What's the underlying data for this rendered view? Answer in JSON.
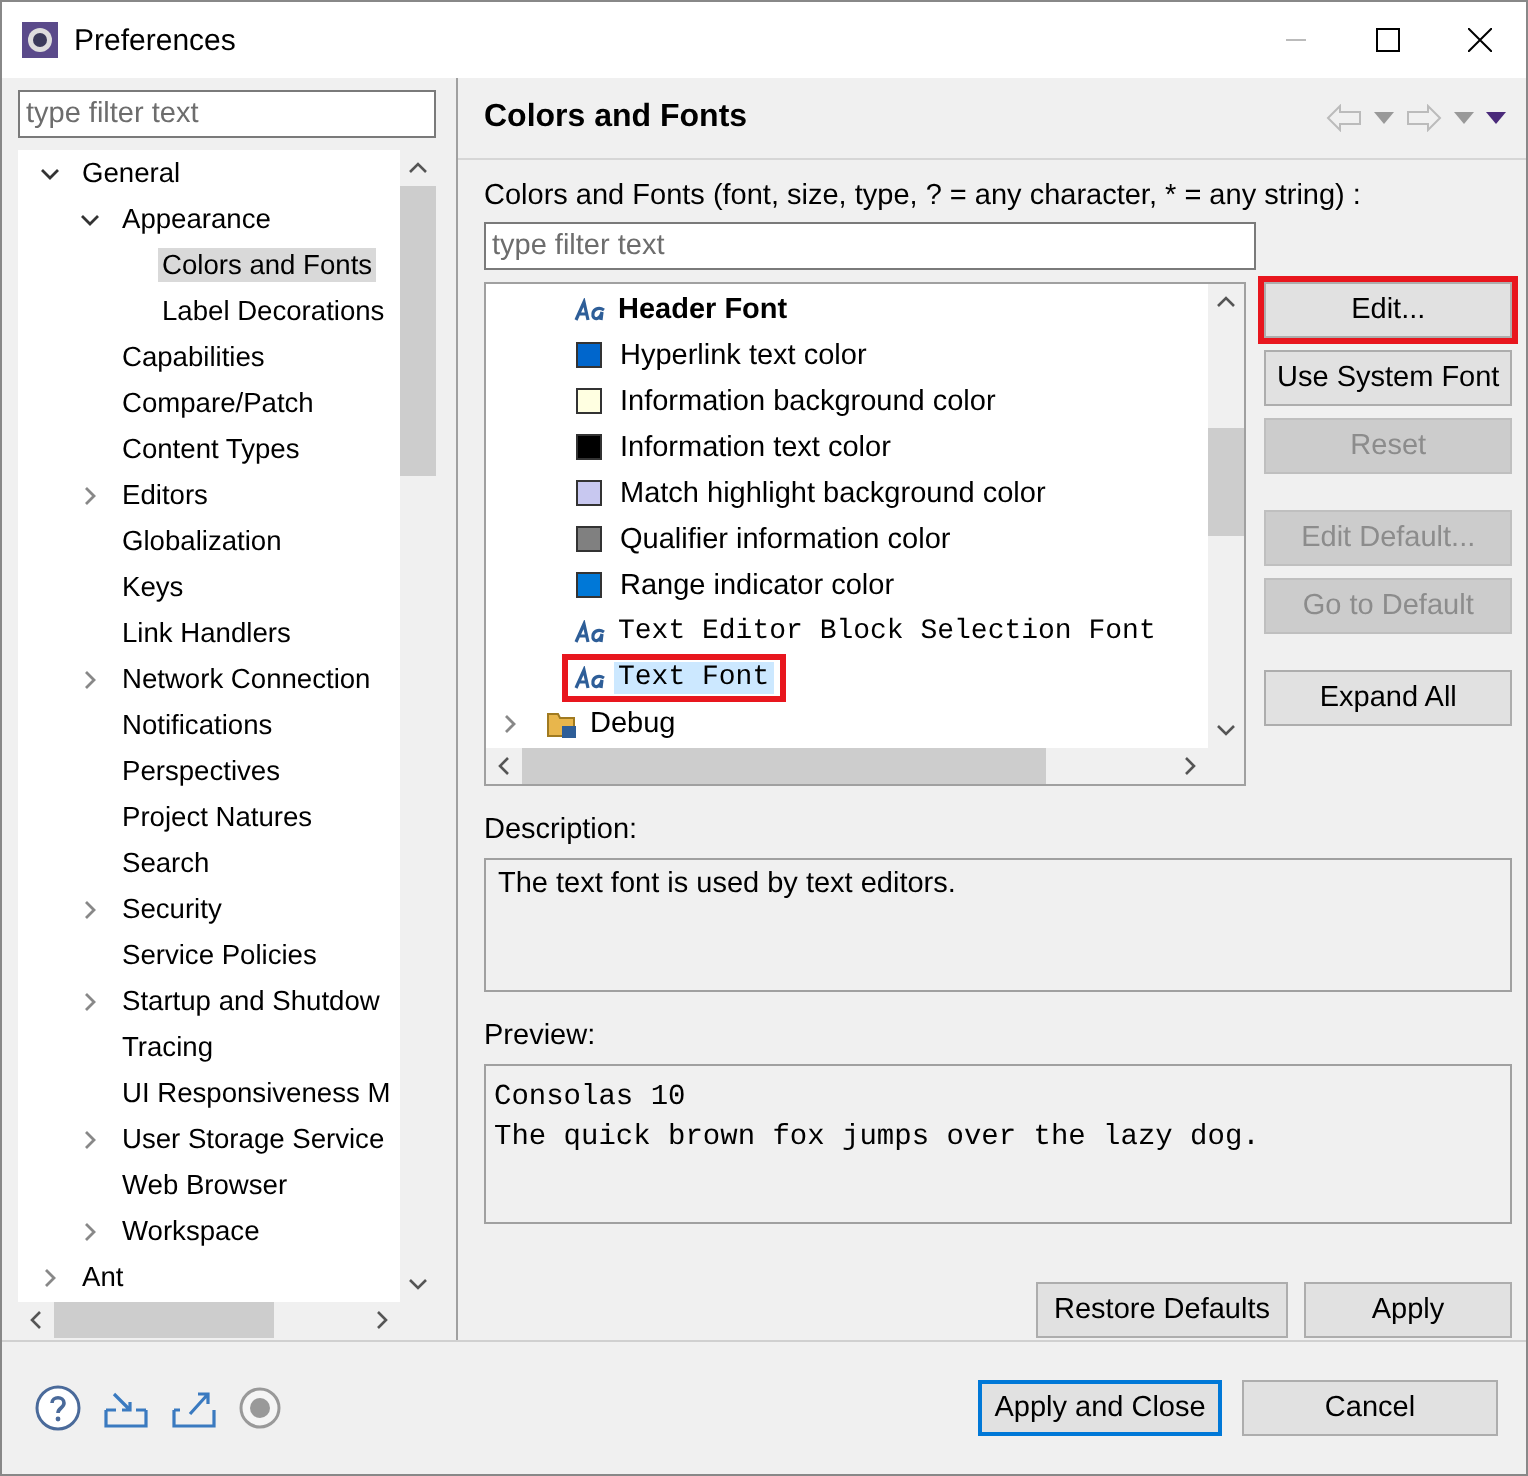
{
  "window": {
    "title": "Preferences"
  },
  "sidebar": {
    "filter": {
      "placeholder": "type filter text"
    },
    "tree": [
      {
        "label": "General",
        "expanded": true,
        "selected": false,
        "children": [
          {
            "label": "Appearance",
            "expanded": true,
            "selected": false,
            "children": [
              {
                "label": "Colors and Fonts",
                "selected": true
              },
              {
                "label": "Label Decorations",
                "selected": false
              }
            ]
          },
          {
            "label": "Capabilities",
            "selected": false
          },
          {
            "label": "Compare/Patch",
            "selected": false
          },
          {
            "label": "Content Types",
            "selected": false
          },
          {
            "label": "Editors",
            "expanded": false,
            "selected": false
          },
          {
            "label": "Globalization",
            "selected": false
          },
          {
            "label": "Keys",
            "selected": false
          },
          {
            "label": "Link Handlers",
            "selected": false
          },
          {
            "label": "Network Connection",
            "expanded": false,
            "selected": false
          },
          {
            "label": "Notifications",
            "selected": false
          },
          {
            "label": "Perspectives",
            "selected": false
          },
          {
            "label": "Project Natures",
            "selected": false
          },
          {
            "label": "Search",
            "selected": false
          },
          {
            "label": "Security",
            "expanded": false,
            "selected": false
          },
          {
            "label": "Service Policies",
            "selected": false
          },
          {
            "label": "Startup and Shutdow",
            "expanded": false,
            "selected": false
          },
          {
            "label": "Tracing",
            "selected": false
          },
          {
            "label": "UI Responsiveness M",
            "selected": false
          },
          {
            "label": "User Storage Service",
            "expanded": false,
            "selected": false
          },
          {
            "label": "Web Browser",
            "selected": false
          },
          {
            "label": "Workspace",
            "expanded": false,
            "selected": false
          }
        ]
      },
      {
        "label": "Ant",
        "expanded": false,
        "selected": false
      }
    ]
  },
  "page": {
    "title": "Colors and Fonts",
    "filter_label": "Colors and Fonts (font, size, type, ? = any character, * = any string) :",
    "filter": {
      "placeholder": "type filter text"
    },
    "items": [
      {
        "kind": "boldfont",
        "label": "Header Font",
        "selected": false,
        "highlighted": false
      },
      {
        "kind": "color",
        "label": "Hyperlink text color",
        "color": "#0066cc",
        "selected": false,
        "highlighted": false
      },
      {
        "kind": "color",
        "label": "Information background color",
        "color": "#ffffe1",
        "selected": false,
        "highlighted": false
      },
      {
        "kind": "color",
        "label": "Information text color",
        "color": "#000000",
        "selected": false,
        "highlighted": false
      },
      {
        "kind": "color",
        "label": "Match highlight background color",
        "color": "#c8c8f0",
        "selected": false,
        "highlighted": false
      },
      {
        "kind": "color",
        "label": "Qualifier information color",
        "color": "#808080",
        "selected": false,
        "highlighted": false
      },
      {
        "kind": "color",
        "label": "Range indicator color",
        "color": "#0078d7",
        "selected": false,
        "highlighted": false
      },
      {
        "kind": "monofont",
        "label": "Text Editor Block Selection Font",
        "selected": false,
        "highlighted": false
      },
      {
        "kind": "monofont",
        "label": "Text Font",
        "selected": true,
        "highlighted": true
      },
      {
        "kind": "category",
        "label": "Debug",
        "expanded": false,
        "selected": false,
        "highlighted": false
      }
    ],
    "button_groups": [
      [
        {
          "label": "Edit...",
          "disabled": false,
          "highlighted": true
        },
        {
          "label": "Use System Font",
          "disabled": false,
          "highlighted": false
        },
        {
          "label": "Reset",
          "disabled": true,
          "highlighted": false
        }
      ],
      [
        {
          "label": "Edit Default...",
          "disabled": true,
          "highlighted": false
        },
        {
          "label": "Go to Default",
          "disabled": true,
          "highlighted": false
        }
      ],
      [
        {
          "label": "Expand All",
          "disabled": false,
          "highlighted": false
        }
      ]
    ],
    "description_label": "Description:",
    "description": "The text font is used by text editors.",
    "preview_label": "Preview:",
    "preview": [
      "Consolas 10",
      "The quick brown fox jumps over the lazy dog."
    ],
    "actions": [
      "Restore Defaults",
      "Apply"
    ]
  },
  "footer": {
    "buttons": [
      {
        "label": "Apply and Close",
        "default": true
      },
      {
        "label": "Cancel",
        "default": false
      }
    ]
  }
}
